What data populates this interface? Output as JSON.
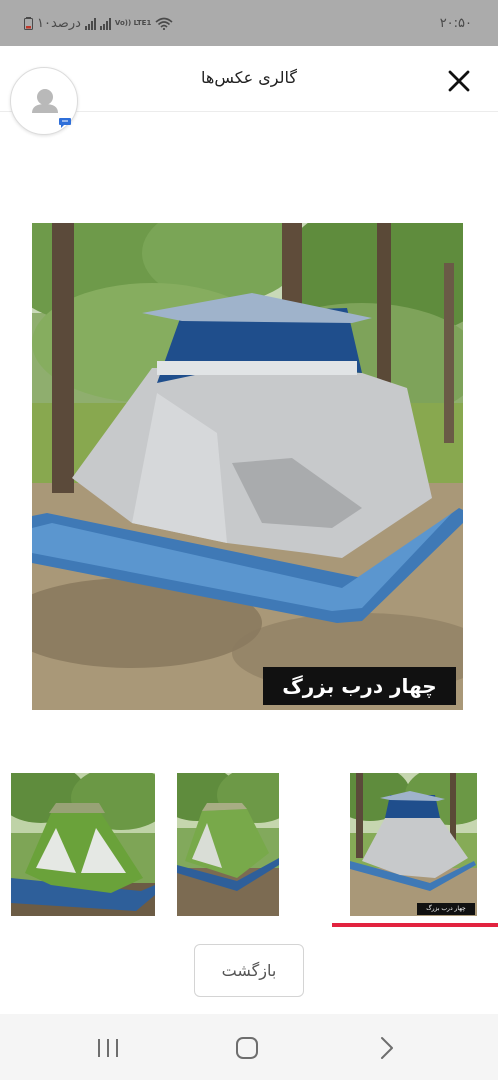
{
  "status_bar": {
    "time": "۲۰:۵۰",
    "battery_text": "۱۰درصد",
    "network_label": "Vo)) LTE1"
  },
  "header": {
    "title": "گالری عکس‌ها",
    "close_icon": "close-icon"
  },
  "avatar": {
    "icon": "user-avatar-icon",
    "badge_icon": "chat-bubble-icon",
    "badge_color": "#2f6fd9"
  },
  "gallery": {
    "main_caption": "چهار درب بزرگ",
    "thumbnails": [
      {
        "caption": "",
        "selected": false
      },
      {
        "caption": "",
        "selected": false
      },
      {
        "caption": "چهار درب بزرگ",
        "selected": true
      }
    ],
    "active_color": "#e2233f"
  },
  "back_button": {
    "label": "بازگشت"
  },
  "nav_bar": {
    "recent_apps_icon": "recent-apps-icon",
    "home_icon": "home-icon",
    "back_icon": "back-chevron-icon"
  }
}
